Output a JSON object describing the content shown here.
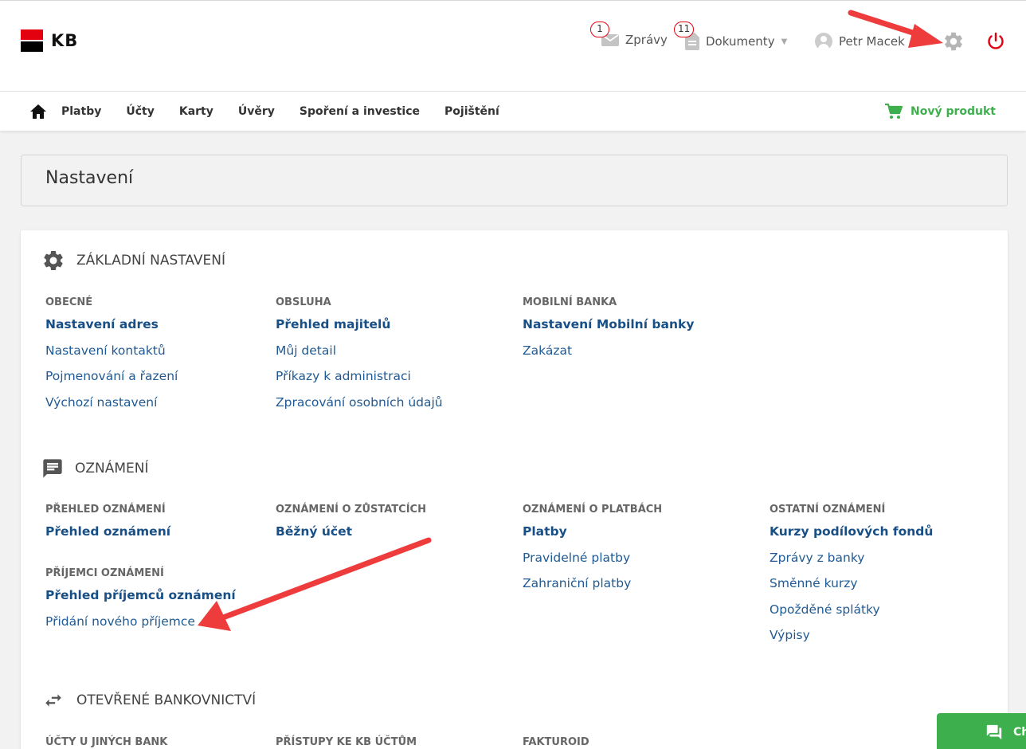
{
  "brand": {
    "logo_text": "KB"
  },
  "topbar": {
    "messages": {
      "label": "Zprávy",
      "badge": "1"
    },
    "documents": {
      "label": "Dokumenty",
      "badge": "11"
    },
    "user": {
      "name": "Petr Macek"
    }
  },
  "nav": {
    "items": [
      "Platby",
      "Účty",
      "Karty",
      "Úvěry",
      "Spoření a investice",
      "Pojištění"
    ],
    "new_product": "Nový produkt"
  },
  "page": {
    "title": "Nastavení"
  },
  "sections": {
    "basic": {
      "title": "ZÁKLADNÍ NASTAVENÍ",
      "cols": [
        {
          "title": "OBECNÉ",
          "links": [
            "Nastavení adres",
            "Nastavení kontaktů",
            "Pojmenování a řazení",
            "Výchozí nastavení"
          ]
        },
        {
          "title": "OBSLUHA",
          "links": [
            "Přehled majitelů",
            "Můj detail",
            "Příkazy k administraci",
            "Zpracování osobních údajů"
          ]
        },
        {
          "title": "MOBILNÍ BANKA",
          "links": [
            "Nastavení Mobilní banky",
            "Zakázat"
          ]
        }
      ]
    },
    "notifications": {
      "title": "OZNÁMENÍ",
      "overview": {
        "title": "PŘEHLED OZNÁMENÍ",
        "links": [
          "Přehled oznámení"
        ]
      },
      "recipients": {
        "title": "PŘÍJEMCI OZNÁMENÍ",
        "links": [
          "Přehled příjemců oznámení",
          "Přidání nového příjemce"
        ]
      },
      "balances": {
        "title": "OZNÁMENÍ O ZŮSTATCÍCH",
        "links": [
          "Běžný účet"
        ]
      },
      "payments": {
        "title": "OZNÁMENÍ O PLATBÁCH",
        "links": [
          "Platby",
          "Pravidelné platby",
          "Zahraniční platby"
        ]
      },
      "other": {
        "title": "OSTATNÍ OZNÁMENÍ",
        "links": [
          "Kurzy podílových fondů",
          "Zprávy z banky",
          "Směnné kurzy",
          "Opožděné splátky",
          "Výpisy"
        ]
      }
    },
    "openbanking": {
      "title": "OTEVŘENÉ BANKOVNICTVÍ",
      "cols": [
        {
          "title": "ÚČTY U JINÝCH BANK"
        },
        {
          "title": "PŘÍSTUPY KE KB ÚČTŮM"
        },
        {
          "title": "FAKTUROID"
        }
      ]
    }
  },
  "chat": {
    "label": "Ch"
  },
  "colors": {
    "brand_red": "#e3000f",
    "link_blue": "#1f5a94",
    "green": "#3db04d",
    "annotation_red": "#ee3b3b"
  }
}
